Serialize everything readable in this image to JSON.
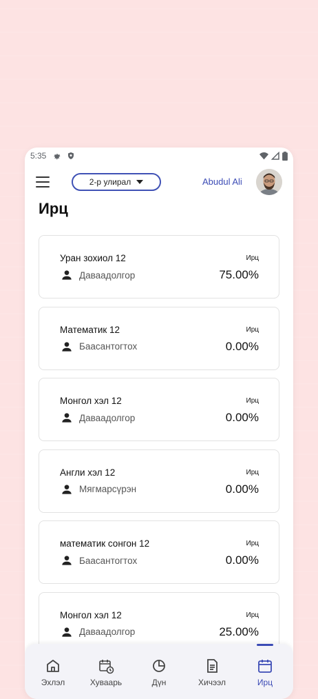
{
  "status_bar": {
    "time": "5:35"
  },
  "header": {
    "semester_label": "2-р улирал",
    "user_name": "Abudul Ali"
  },
  "page": {
    "title": "Ирц"
  },
  "attendance": {
    "items": [
      {
        "subject": "Уран зохиол 12",
        "teacher": "Даваадолгор",
        "label": "Ирц",
        "value": "75.00%"
      },
      {
        "subject": "Математик 12",
        "teacher": "Баасантогтох",
        "label": "Ирц",
        "value": "0.00%"
      },
      {
        "subject": "Монгол хэл 12",
        "teacher": "Даваадолгор",
        "label": "Ирц",
        "value": "0.00%"
      },
      {
        "subject": "Англи хэл 12",
        "teacher": "Мягмарсүрэн",
        "label": "Ирц",
        "value": "0.00%"
      },
      {
        "subject": "математик сонгон 12",
        "teacher": "Баасантогтох",
        "label": "Ирц",
        "value": "0.00%"
      },
      {
        "subject": "Монгол хэл 12",
        "teacher": "Даваадолгор",
        "label": "Ирц",
        "value": "25.00%"
      }
    ]
  },
  "bottom_nav": {
    "items": [
      {
        "label": "Эхлэл",
        "icon": "home-icon"
      },
      {
        "label": "Хуваарь",
        "icon": "calendar-clock-icon"
      },
      {
        "label": "Дүн",
        "icon": "pie-chart-icon"
      },
      {
        "label": "Хичээл",
        "icon": "document-icon"
      },
      {
        "label": "Ирц",
        "icon": "calendar-icon"
      }
    ],
    "active_index": 4
  },
  "colors": {
    "accent": "#3b4bb5",
    "background": "#fde3e3"
  }
}
